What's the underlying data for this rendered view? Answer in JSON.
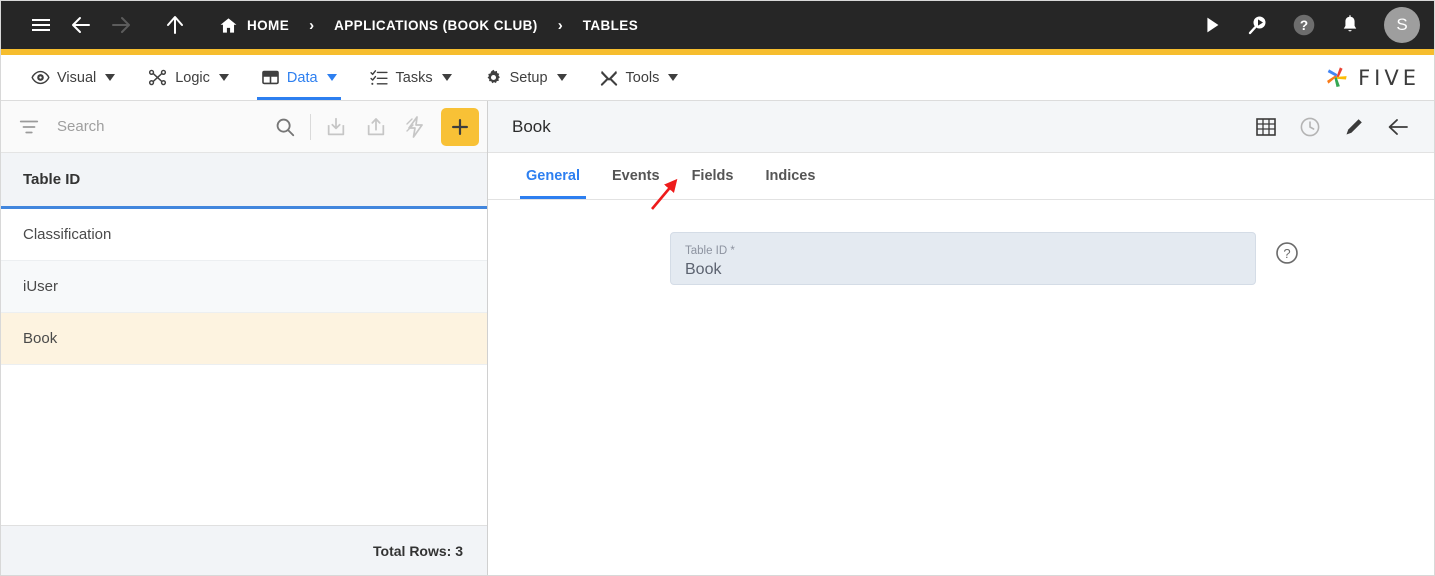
{
  "topbar": {
    "menu_icon": "hamburger-icon",
    "back_icon": "arrow-left-icon",
    "forward_icon": "arrow-right-icon",
    "up_icon": "arrow-up-icon",
    "home_label": "HOME",
    "separator": "›",
    "breadcrumbs": [
      {
        "label": "APPLICATIONS (BOOK CLUB)"
      },
      {
        "label": "TABLES"
      }
    ],
    "actions": [
      {
        "name": "run-icon"
      },
      {
        "name": "search-run-icon"
      },
      {
        "name": "help-icon"
      },
      {
        "name": "notifications-bell-icon"
      }
    ],
    "avatar_initial": "S",
    "accent_color": "#f6bd2e",
    "background_color": "#262626"
  },
  "menubar": {
    "items": [
      {
        "label": "Visual",
        "icon": "eye-icon",
        "active": false
      },
      {
        "label": "Logic",
        "icon": "logic-nodes-icon",
        "active": false
      },
      {
        "label": "Data",
        "icon": "table-grid-icon",
        "active": true
      },
      {
        "label": "Tasks",
        "icon": "task-list-icon",
        "active": false
      },
      {
        "label": "Setup",
        "icon": "gear-icon",
        "active": false
      },
      {
        "label": "Tools",
        "icon": "tools-icon",
        "active": false
      }
    ],
    "brand": "FIVE",
    "active_color": "#2d7ff0"
  },
  "left_panel": {
    "search": {
      "placeholder": "Search",
      "value": ""
    },
    "toolbar": [
      {
        "name": "filter-icon"
      },
      {
        "name": "search-icon"
      },
      {
        "name": "import-icon"
      },
      {
        "name": "export-icon"
      },
      {
        "name": "quick-action-icon"
      },
      {
        "name": "add-icon",
        "label": "+"
      }
    ],
    "column_header": "Table ID",
    "rows": [
      {
        "label": "Classification",
        "selected": false
      },
      {
        "label": "iUser",
        "selected": false
      },
      {
        "label": "Book",
        "selected": true
      }
    ],
    "footer_text": "Total Rows: 3",
    "selected_row_color": "#fdf3e0",
    "header_underline_color": "#4286dd"
  },
  "right_panel": {
    "title": "Book",
    "actions": [
      {
        "name": "table-view-icon"
      },
      {
        "name": "history-clock-icon"
      },
      {
        "name": "edit-pencil-icon"
      },
      {
        "name": "back-arrow-icon"
      }
    ],
    "tabs": [
      {
        "label": "General",
        "active": true
      },
      {
        "label": "Events",
        "active": false
      },
      {
        "label": "Fields",
        "active": false
      },
      {
        "label": "Indices",
        "active": false
      }
    ],
    "form": {
      "field_label": "Table ID *",
      "field_value": "Book",
      "help_icon": "help-circle-icon"
    }
  },
  "annotation": {
    "type": "arrow",
    "color": "#ee1b1b",
    "points_at": "Fields"
  }
}
